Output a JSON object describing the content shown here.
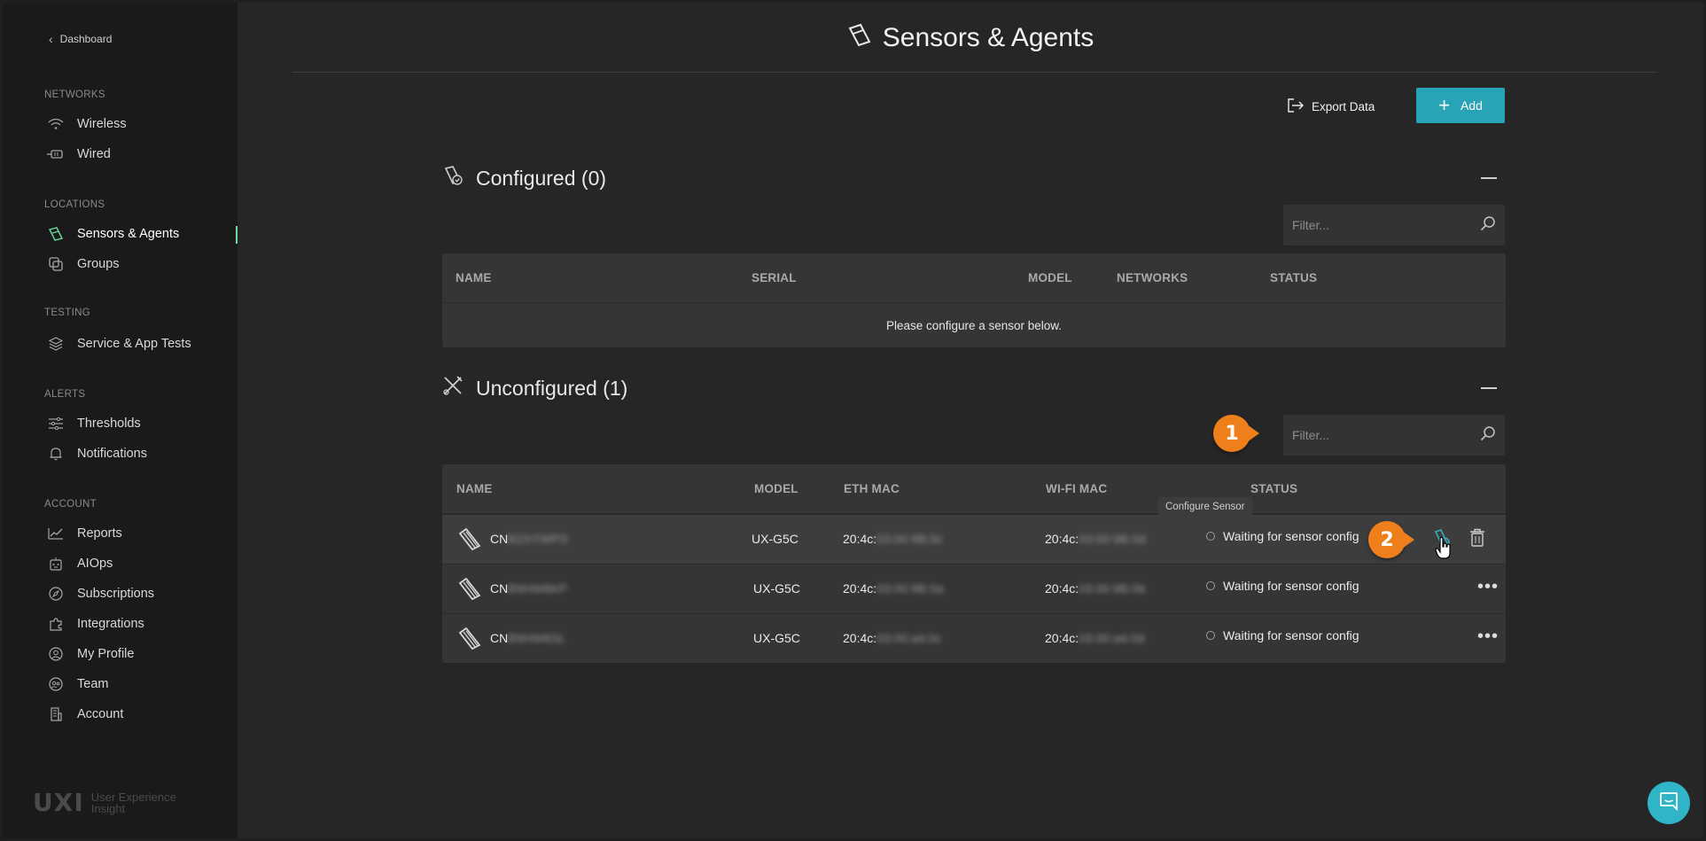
{
  "sidebar": {
    "back_label": "Dashboard",
    "sections": {
      "networks": "NETWORKS",
      "locations": "LOCATIONS",
      "testing": "TESTING",
      "alerts": "ALERTS",
      "account": "ACCOUNT"
    },
    "items": {
      "wireless": "Wireless",
      "wired": "Wired",
      "sensors": "Sensors & Agents",
      "groups": "Groups",
      "service_tests": "Service & App Tests",
      "thresholds": "Thresholds",
      "notifications": "Notifications",
      "reports": "Reports",
      "aiops": "AIOps",
      "subscriptions": "Subscriptions",
      "integrations": "Integrations",
      "my_profile": "My Profile",
      "team": "Team",
      "account": "Account"
    },
    "active_item": "Sensors & Agents",
    "brand_logo": "UXI",
    "brand_tagline_1": "User Experience",
    "brand_tagline_2": "Insight"
  },
  "header": {
    "title": "Sensors & Agents",
    "export_label": "Export Data",
    "add_label": "Add"
  },
  "configured": {
    "title": "Configured (0)",
    "filter_placeholder": "Filter...",
    "columns": [
      "NAME",
      "SERIAL",
      "MODEL",
      "NETWORKS",
      "STATUS"
    ],
    "empty_message": "Please configure a sensor below."
  },
  "unconfigured": {
    "title": "Unconfigured (1)",
    "filter_placeholder": "Filter...",
    "columns": [
      "NAME",
      "MODEL",
      "ETH MAC",
      "WI-FI MAC",
      "STATUS"
    ],
    "rows": [
      {
        "name_prefix": "CN",
        "name_hidden": "B2XYWPS",
        "model": "UX-G5C",
        "eth_prefix": "20:4c:",
        "eth_hidden": "03:00:9B:0c",
        "wifi_prefix": "20:4c:",
        "wifi_hidden": "03:00:9B:0d",
        "status": "Waiting for sensor config"
      },
      {
        "name_prefix": "CN",
        "name_hidden": "B9HW6KP",
        "model": "UX-G5C",
        "eth_prefix": "20:4c:",
        "eth_hidden": "03:00:9B:0a",
        "wifi_prefix": "20:4c:",
        "wifi_hidden": "03:00:9B:0b",
        "status": "Waiting for sensor config"
      },
      {
        "name_prefix": "CN",
        "name_hidden": "B9HW6SL",
        "model": "UX-G5C",
        "eth_prefix": "20:4c:",
        "eth_hidden": "03:00:a4:0c",
        "wifi_prefix": "20:4c:",
        "wifi_hidden": "03:00:a4:0d",
        "status": "Waiting for sensor config"
      }
    ]
  },
  "tooltip": "Configure Sensor",
  "callouts": [
    "1",
    "2"
  ],
  "colors": {
    "accent": "#29a3b6",
    "active": "#6dd7a0",
    "callout": "#ef7f1a"
  }
}
